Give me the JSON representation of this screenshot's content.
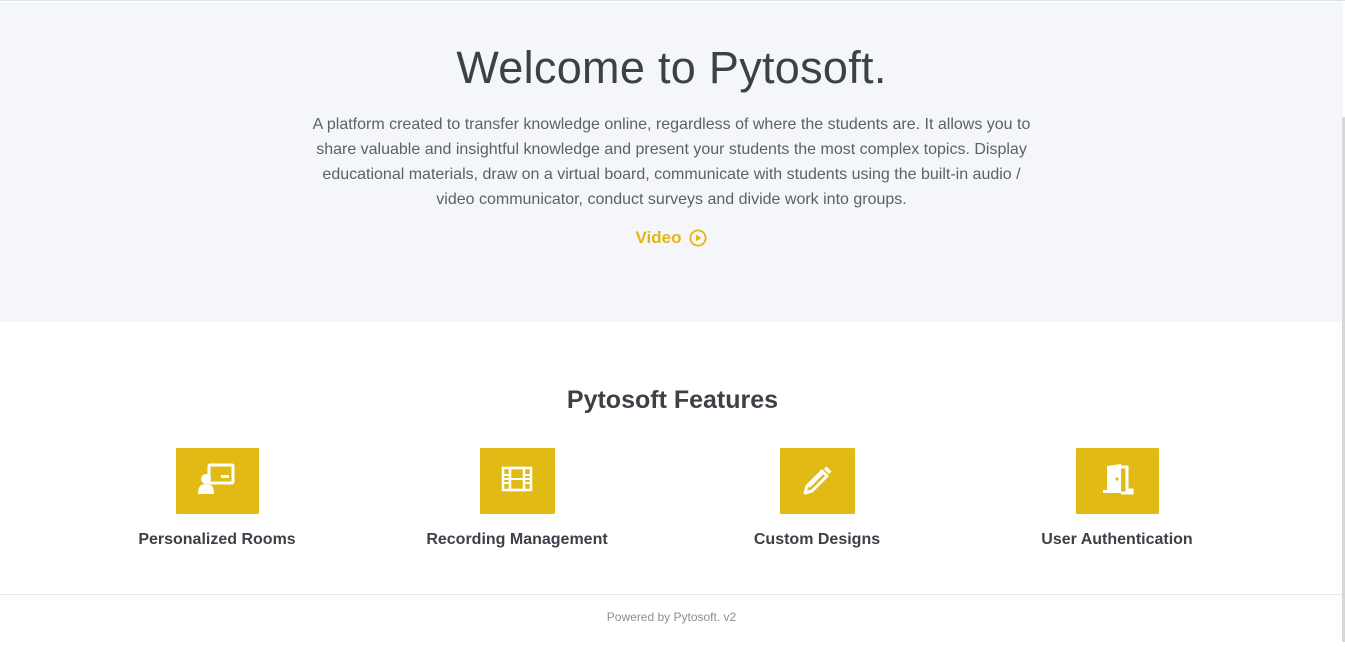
{
  "hero": {
    "title": "Welcome to Pytosoft.",
    "description": "A platform created to transfer knowledge online, regardless of where the students are. It allows you to share valuable and insightful knowledge and present your students the most complex topics. Display educational materials, draw on a virtual board, communicate with students using the built-in audio / video communicator, conduct surveys and divide work into groups.",
    "video_label": "Video",
    "video_icon": "play-circle-icon"
  },
  "features": {
    "title": "Pytosoft Features",
    "items": [
      {
        "label": "Personalized Rooms",
        "icon": "presentation-room-icon"
      },
      {
        "label": "Recording Management",
        "icon": "film-icon"
      },
      {
        "label": "Custom Designs",
        "icon": "pencil-icon"
      },
      {
        "label": "User Authentication",
        "icon": "door-icon"
      }
    ]
  },
  "footer": {
    "text": "Powered by Pytosoft. v2"
  },
  "colors": {
    "accent": "#e2ba15",
    "hero_background": "#f5f6f9",
    "heading_text": "#3c4148"
  }
}
